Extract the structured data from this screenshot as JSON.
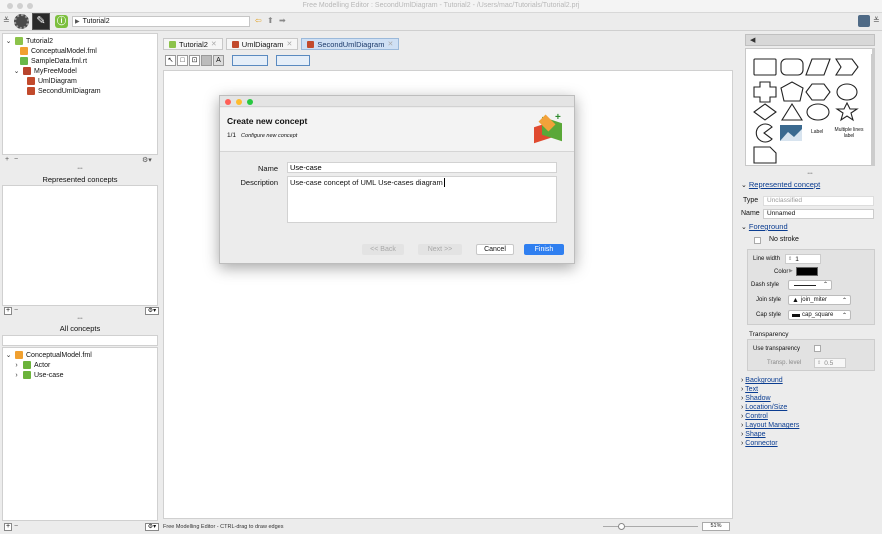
{
  "window": {
    "title": "Free Modelling Editor : SecondUmlDiagram - Tutorial2 - /Users/mac/Tutorials/Tutorial2.prj"
  },
  "toolbar": {
    "project": "Tutorial2"
  },
  "tree": {
    "project": "Tutorial2",
    "items": [
      "ConceptualModel.fml",
      "SampleData.fml.rt",
      "MyFreeModel",
      "UmlDiagram",
      "SecondUmlDiagram"
    ]
  },
  "left": {
    "represented_title": "Represented concepts",
    "all_title": "All concepts",
    "dots": "•••",
    "model": "ConceptualModel.fml",
    "concepts": [
      "Actor",
      "Use-case"
    ],
    "plus": "+",
    "minus": "−"
  },
  "tabs": [
    {
      "label": "Tutorial2"
    },
    {
      "label": "UmlDiagram"
    },
    {
      "label": "SecondUmlDiagram"
    }
  ],
  "dialog": {
    "title": "Create new concept",
    "step": "1/1",
    "step_desc": "Configure new concept",
    "name_label": "Name",
    "name_value": "Use-case",
    "desc_label": "Description",
    "desc_value": "Use-case concept of UML Use-cases diagram",
    "back": "<< Back",
    "next": "Next >>",
    "cancel": "Cancel",
    "finish": "Finish"
  },
  "palette": {
    "label1": "Label",
    "label2": "Multiple lines label"
  },
  "inspector": {
    "section": "Represented concept",
    "type_label": "Type",
    "type_value": "Unclassified",
    "name_label": "Name",
    "name_value": "Unnamed",
    "foreground": "Foreground",
    "no_stroke": "No stroke",
    "line_width_label": "Line width",
    "line_width_value": "1",
    "color_label": "Color",
    "dash_label": "Dash style",
    "join_label": "Join style",
    "join_value": "join_miter",
    "cap_label": "Cap style",
    "cap_value": "cap_square",
    "transparency": "Transparency",
    "use_transparency": "Use transparency",
    "transp_level_label": "Transp. level",
    "transp_level_value": "0.5",
    "links": [
      "Background",
      "Text",
      "Shadow",
      "Location/Size",
      "Control",
      "Layout Managers",
      "Shape",
      "Connector"
    ]
  },
  "status": {
    "text": "Free Modelling Editor - CTRL-drag to draw edges",
    "zoom": "51%"
  }
}
